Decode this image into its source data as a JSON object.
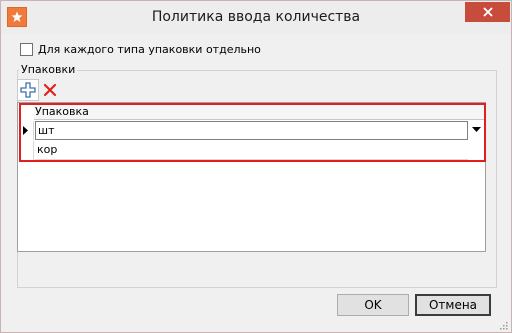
{
  "window": {
    "title": "Политика ввода количества",
    "icons": {
      "app": "star-icon",
      "close": "close-icon"
    },
    "colors": {
      "close_button": "#c74c3c",
      "app_icon": "#f07a3b",
      "highlight": "#e11f1f"
    }
  },
  "options": {
    "per_package_checkbox": {
      "label": "Для каждого типа упаковки отдельно",
      "checked": false
    }
  },
  "packages_group": {
    "title": "Упаковки",
    "toolbar": {
      "add_icon": "plus-icon",
      "delete_icon": "delete-x-icon"
    },
    "table": {
      "columns": [
        "Упаковка"
      ],
      "rows": [
        {
          "value": "шт",
          "current": true
        },
        {
          "value": "кор",
          "current": false
        }
      ]
    }
  },
  "buttons": {
    "ok": "OK",
    "cancel": "Отмена"
  }
}
